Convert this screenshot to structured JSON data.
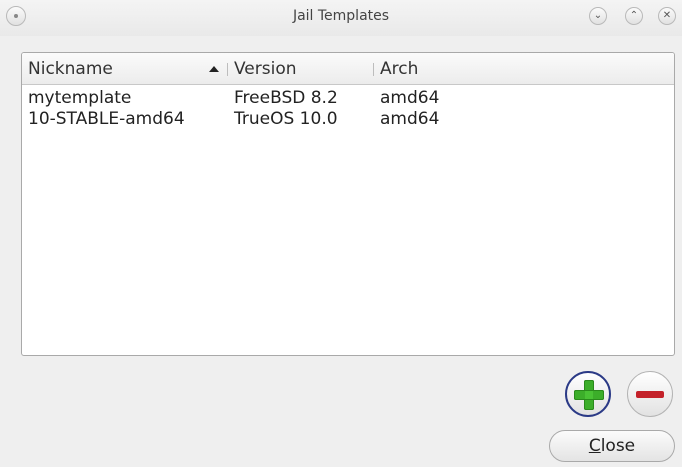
{
  "window": {
    "title": "Jail Templates",
    "controls": {
      "minimize_glyph": "⌄",
      "maximize_glyph": "⌃",
      "close_glyph": "✕"
    }
  },
  "table": {
    "columns": [
      "Nickname",
      "Version",
      "Arch"
    ],
    "sort_column": "Nickname",
    "sort_order": "ascending",
    "rows": [
      {
        "nickname": "mytemplate",
        "version": "FreeBSD 8.2",
        "arch": "amd64"
      },
      {
        "nickname": "10-STABLE-amd64",
        "version": "TrueOS 10.0",
        "arch": "amd64"
      }
    ]
  },
  "actions": {
    "add_icon": "plus-icon",
    "remove_icon": "minus-icon",
    "close_mnemonic": "C",
    "close_rest": "lose"
  },
  "colors": {
    "add_green": "#3cae2a",
    "remove_red": "#c4222a",
    "focus_ring": "#2b3a86"
  }
}
